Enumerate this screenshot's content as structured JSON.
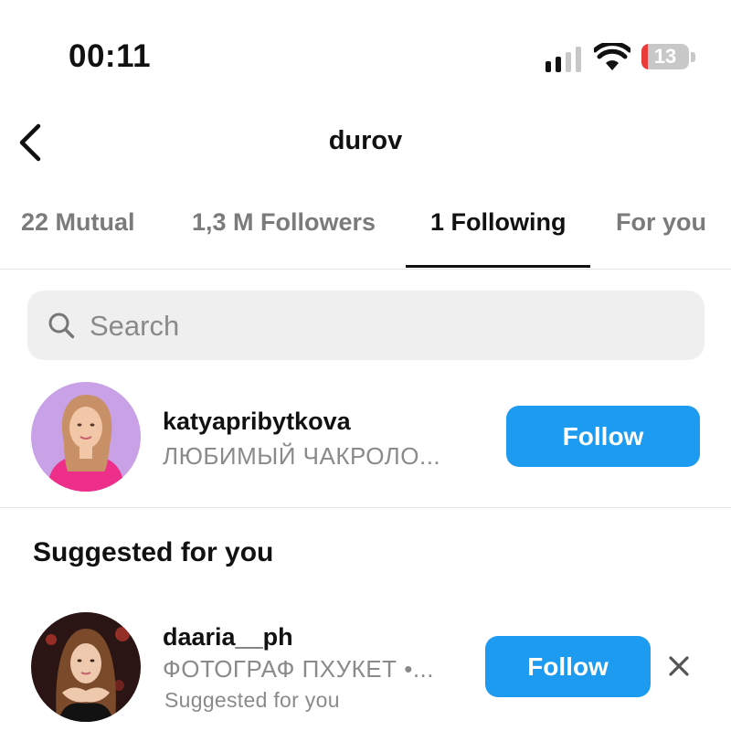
{
  "status_bar": {
    "time": "00:11",
    "battery_level": "13",
    "battery_fraction": 0.13,
    "battery_color": "#ea3a3a"
  },
  "header": {
    "title": "durov"
  },
  "tabs": [
    {
      "label": "22 Mutual",
      "active": false
    },
    {
      "label": "1,3 M Followers",
      "active": false
    },
    {
      "label": "1 Following",
      "active": true
    },
    {
      "label": "For you",
      "active": false
    }
  ],
  "search": {
    "placeholder": "Search",
    "icon": "search-icon"
  },
  "following": [
    {
      "username": "katyapribytkova",
      "subtitle": "ЛЮБИМЫЙ ЧАКРОЛО...",
      "button_label": "Follow"
    }
  ],
  "suggested": {
    "heading": "Suggested for you",
    "items": [
      {
        "username": "daaria__ph",
        "subtitle": "ФОТОГРАФ ПХУКЕТ •...",
        "note": "Suggested for you",
        "button_label": "Follow"
      }
    ]
  },
  "colors": {
    "accent": "#1d9bf0",
    "search_bg": "#efefef",
    "muted_text": "#8a8a8a"
  }
}
